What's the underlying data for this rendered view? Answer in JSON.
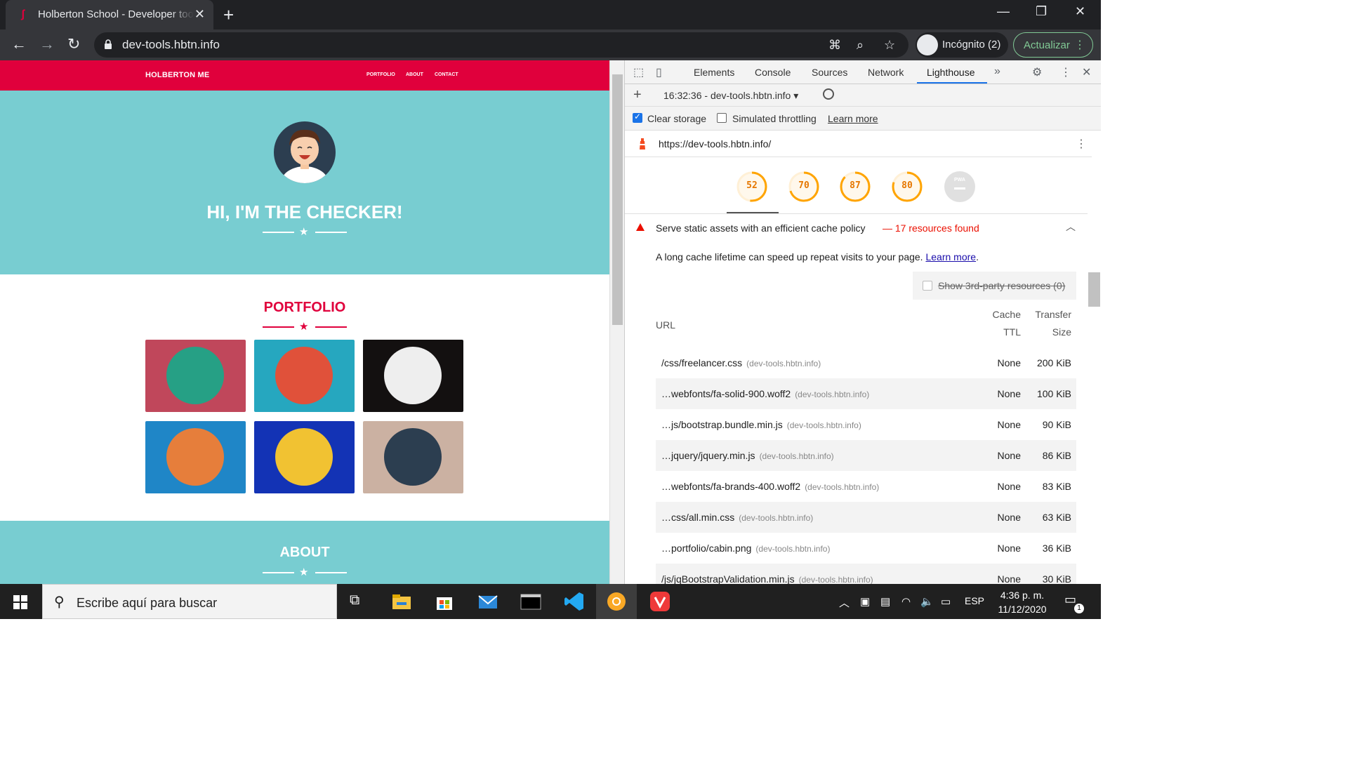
{
  "browser": {
    "tab_title": "Holberton School - Developer tools",
    "url": "dev-tools.hbtn.info",
    "incognito_label": "Incógnito (2)",
    "update_label": "Actualizar"
  },
  "page": {
    "brand": "HOLBERTON ME",
    "nav_links": [
      "PORTFOLIO",
      "ABOUT",
      "CONTACT"
    ],
    "hero_title": "HI, I'M THE CHECKER!",
    "portfolio_title": "PORTFOLIO",
    "about_title": "ABOUT",
    "tiles": [
      {
        "bg": "#c0475b",
        "circle": "#26a085",
        "icon": "cabin-icon"
      },
      {
        "bg": "#26a7bf",
        "circle": "#e0513a",
        "icon": "cake-icon"
      },
      {
        "bg": "#131010",
        "circle": "#eeeeee",
        "icon": "circus-tent-icon"
      },
      {
        "bg": "#1f86c7",
        "circle": "#e67e3b",
        "icon": "game-controller-icon"
      },
      {
        "bg": "#1333b5",
        "circle": "#f1c232",
        "icon": "safe-icon"
      },
      {
        "bg": "#cbb1a2",
        "circle": "#2c3e50",
        "icon": "submarine-icon"
      }
    ]
  },
  "devtools": {
    "tabs": [
      "Elements",
      "Console",
      "Sources",
      "Network",
      "Lighthouse"
    ],
    "active_tab": "Lighthouse",
    "report_label": "16:32:36 - dev-tools.hbtn.info",
    "clear_storage_label": "Clear storage",
    "clear_storage_checked": true,
    "throttling_label": "Simulated throttling",
    "throttling_checked": false,
    "learn_more": "Learn more",
    "audited_url": "https://dev-tools.hbtn.info/",
    "scores": [
      {
        "value": "52",
        "fraction": 0.52
      },
      {
        "value": "70",
        "fraction": 0.7
      },
      {
        "value": "87",
        "fraction": 0.87
      },
      {
        "value": "80",
        "fraction": 0.8
      }
    ],
    "pwa_label": "PWA",
    "audit_title": "Serve static assets with an efficient cache policy",
    "audit_display": "— 17 resources found",
    "audit_desc": "A long cache lifetime can speed up repeat visits to your page.",
    "audit_learn_more": "Learn more",
    "third_party_label": "Show 3rd-party resources (0)",
    "col_url": "URL",
    "col_cache_1": "Cache",
    "col_cache_2": "TTL",
    "col_size_1": "Transfer",
    "col_size_2": "Size",
    "rows": [
      {
        "path": "/css/freelancer.css",
        "host": "(dev-tools.hbtn.info)",
        "ttl": "None",
        "size": "200 KiB"
      },
      {
        "path": "…webfonts/fa-solid-900.woff2",
        "host": "(dev-tools.hbtn.info)",
        "ttl": "None",
        "size": "100 KiB"
      },
      {
        "path": "…js/bootstrap.bundle.min.js",
        "host": "(dev-tools.hbtn.info)",
        "ttl": "None",
        "size": "90 KiB"
      },
      {
        "path": "…jquery/jquery.min.js",
        "host": "(dev-tools.hbtn.info)",
        "ttl": "None",
        "size": "86 KiB"
      },
      {
        "path": "…webfonts/fa-brands-400.woff2",
        "host": "(dev-tools.hbtn.info)",
        "ttl": "None",
        "size": "83 KiB"
      },
      {
        "path": "…css/all.min.css",
        "host": "(dev-tools.hbtn.info)",
        "ttl": "None",
        "size": "63 KiB"
      },
      {
        "path": "…portfolio/cabin.png",
        "host": "(dev-tools.hbtn.info)",
        "ttl": "None",
        "size": "36 KiB"
      },
      {
        "path": "/js/jqBootstrapValidation.min.js",
        "host": "(dev-tools.hbtn.info)",
        "ttl": "None",
        "size": "30 KiB"
      }
    ]
  },
  "taskbar": {
    "search_placeholder": "Escribe aquí para buscar",
    "lang": "ESP",
    "time": "4:36 p. m.",
    "date": "11/12/2020",
    "notification_count": "1"
  },
  "colors": {
    "brand_red": "#e0003c",
    "teal": "#78cdd1",
    "score_orange": "#ffa400",
    "fail_red": "#eb0f00"
  }
}
